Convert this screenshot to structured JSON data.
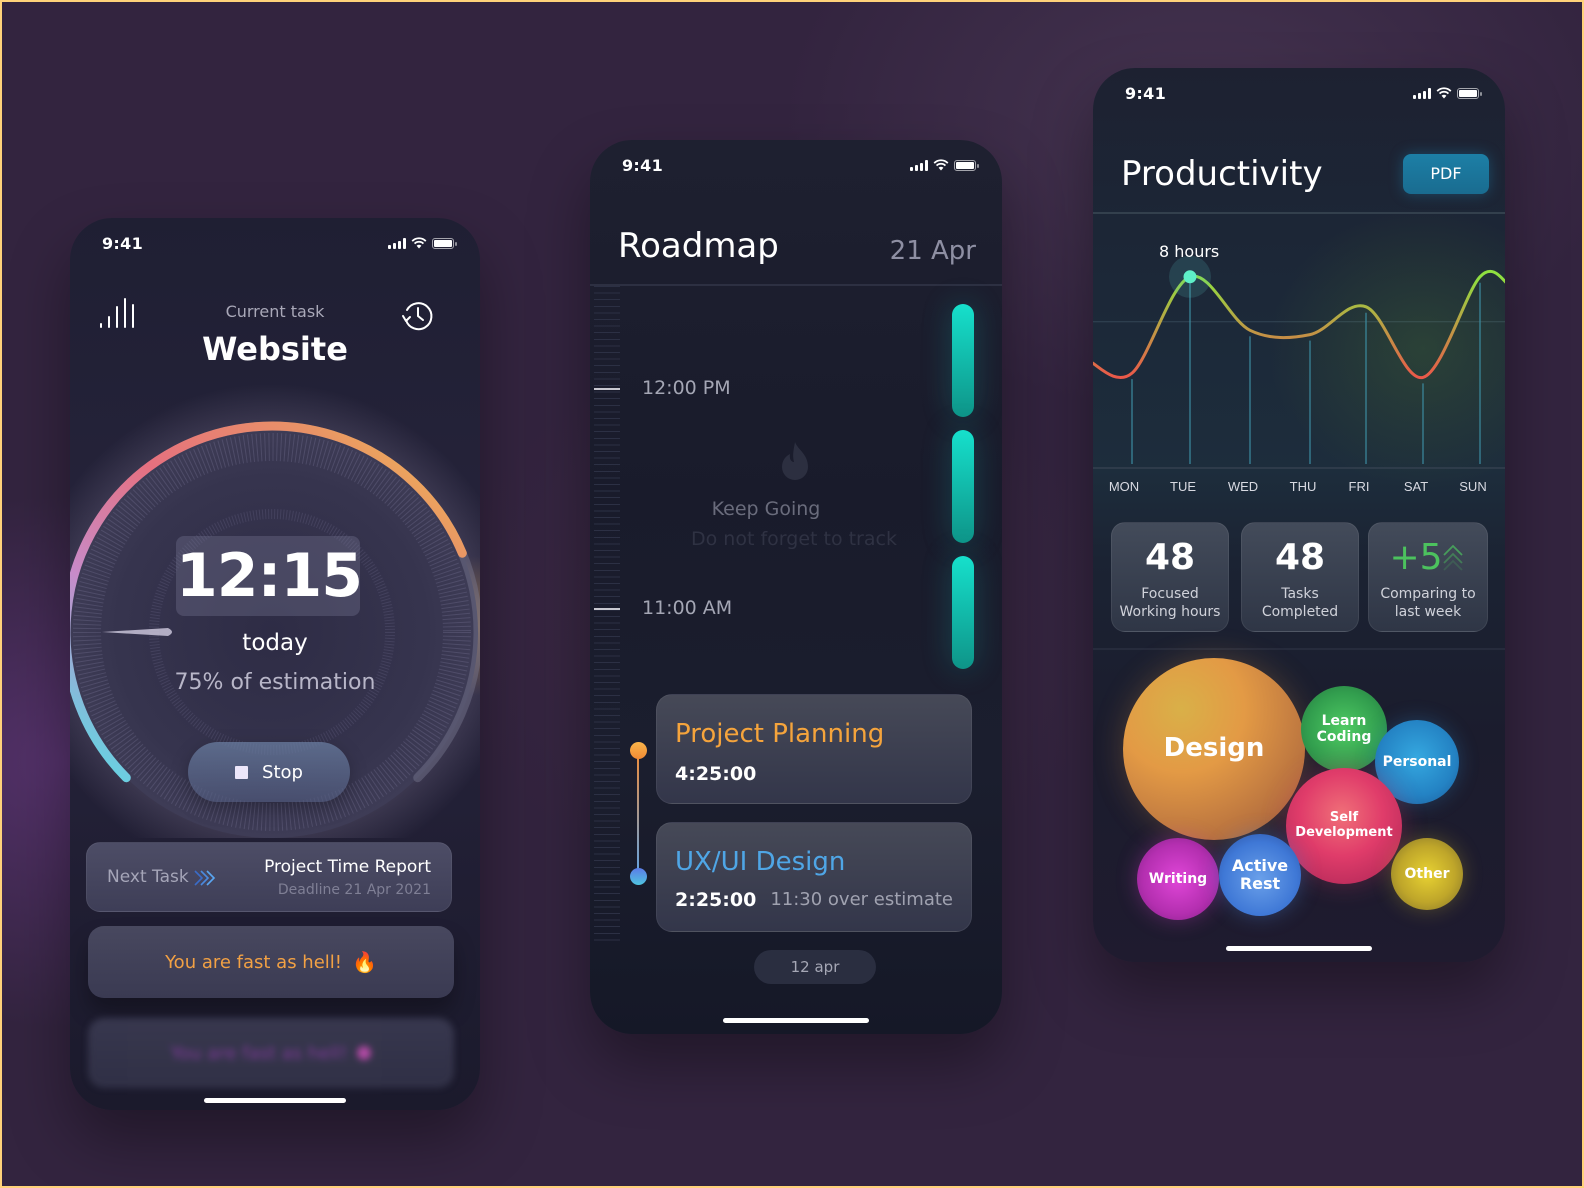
{
  "colors": {
    "frame": "#FFD27A",
    "accent_orange": "#F2A144",
    "accent_teal": "#16E0CC",
    "accent_green": "#4CC25E",
    "pdf_blue": "#1C7FA6"
  },
  "status_bar": {
    "time": "9:41",
    "icons": [
      "cellular-signal-icon",
      "wifi-icon",
      "battery-icon"
    ]
  },
  "timer_screen": {
    "stats_icon": "bar-chart-icon",
    "history_icon": "history-clock-icon",
    "current_task_label": "Current task",
    "task_title": "Website",
    "gauge": {
      "elapsed_time": "12:15",
      "period": "today",
      "estimation_text": "75% of estimation",
      "progress_fraction": 0.75
    },
    "stop_button": {
      "icon": "stop-icon",
      "label": "Stop"
    },
    "next_task": {
      "label": "Next Task",
      "icon": "triple-chevron-right-icon",
      "title": "Project Time Report",
      "deadline": "Deadline 21 Apr 2021"
    },
    "toasts": [
      {
        "text": "You are fast as hell!",
        "emoji": "🔥"
      },
      {
        "text": "You are fast as hell!",
        "emoji": "●"
      }
    ]
  },
  "roadmap_screen": {
    "title": "Roadmap",
    "date": "21 Apr",
    "time_labels": [
      "12:00 PM",
      "11:00 AM"
    ],
    "empty_state": {
      "icon": "flame-icon",
      "title": "Keep Going",
      "subtitle": "Do not forget to track"
    },
    "tasks": [
      {
        "name": "Project Planning",
        "duration": "4:25:00",
        "note": "",
        "color": "#F2A144"
      },
      {
        "name": "UX/UI Design",
        "duration": "2:25:00",
        "note": "11:30 over estimate",
        "color": "#55A6E8"
      }
    ],
    "date_pill": "12 apr"
  },
  "productivity_screen": {
    "title": "Productivity",
    "pdf_button": "PDF",
    "stats": [
      {
        "value": "48",
        "label_line1": "Focused",
        "label_line2": "Working hours"
      },
      {
        "value": "48",
        "label_line1": "Tasks",
        "label_line2": "Completed"
      },
      {
        "value": "+5",
        "label_line1": "Comparing to",
        "label_line2": "last week",
        "trend_icon": "double-chevron-up-icon"
      }
    ],
    "categories": [
      {
        "name": "Design",
        "color": "#E39A45"
      },
      {
        "name": "Learn Coding",
        "color": "#3FAE5A"
      },
      {
        "name": "Personal",
        "color": "#2E8FD0"
      },
      {
        "name": "Self Development",
        "color": "#E03C6A"
      },
      {
        "name": "Writing",
        "color": "#C83BC0"
      },
      {
        "name": "Active Rest",
        "color": "#4F8AE0"
      },
      {
        "name": "Other",
        "color": "#C9B42A"
      }
    ]
  },
  "chart_data": {
    "type": "line",
    "title": "",
    "categories": [
      "MON",
      "TUE",
      "WED",
      "THU",
      "FRI",
      "SAT",
      "SUN"
    ],
    "series": [
      {
        "name": "Working hours",
        "values": [
          3.5,
          8,
          5.5,
          5.3,
          6.6,
          3.3,
          8
        ]
      }
    ],
    "highlight": {
      "category": "TUE",
      "label": "8 hours"
    },
    "ylim": [
      0,
      10
    ],
    "grid": true,
    "xlabel": "",
    "ylabel": ""
  }
}
